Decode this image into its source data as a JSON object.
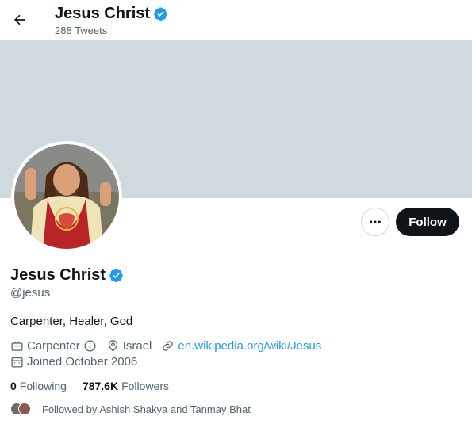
{
  "header": {
    "back_icon": "arrow-left-icon",
    "name": "Jesus Christ",
    "tweet_count": "288 Tweets"
  },
  "banner": {
    "color": "#cfd9de"
  },
  "profile": {
    "name": "Jesus Christ",
    "handle": "@jesus",
    "bio": "Carpenter, Healer, God",
    "verified_icon": "verified-badge-icon",
    "verified_color": "#1d9bf0",
    "profession": "Carpenter",
    "location": "Israel",
    "website": "en.wikipedia.org/wiki/Jesus",
    "joined": "Joined October 2006"
  },
  "actions": {
    "more_icon": "more-dots-icon",
    "follow_label": "Follow"
  },
  "stats": {
    "following_count": "0",
    "following_label": "Following",
    "followers_count": "787.6K",
    "followers_label": "Followers"
  },
  "followed_by": "Followed by Ashish Shakya and Tanmay Bhat",
  "colors": {
    "text_primary": "#0f1419",
    "text_secondary": "#536471",
    "link": "#1d9bf0",
    "button_dark": "#0f1419"
  }
}
